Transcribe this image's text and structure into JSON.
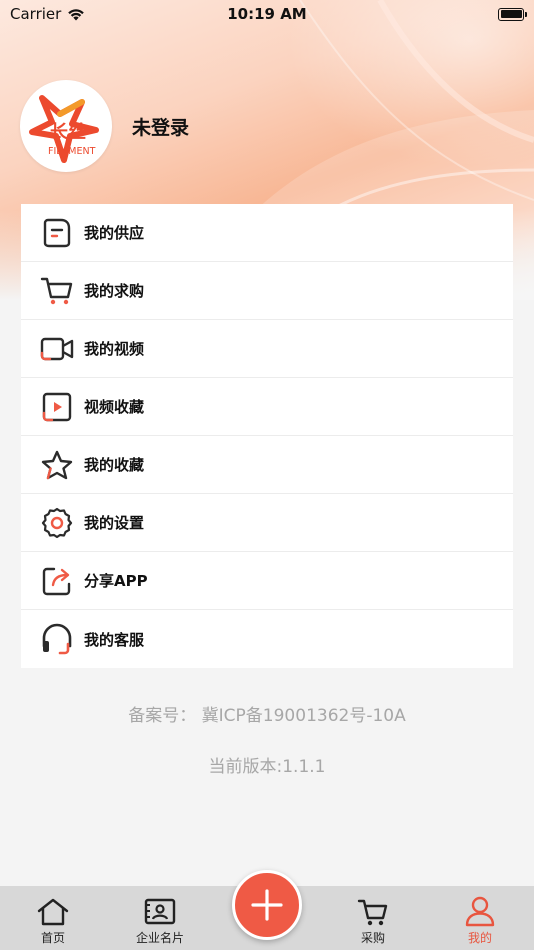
{
  "status_bar": {
    "carrier": "Carrier",
    "time": "10:19 AM"
  },
  "profile": {
    "name": "未登录",
    "logo_text": "长丝",
    "logo_subtext": "FILAMENT"
  },
  "menu": {
    "items": [
      {
        "label": "我的供应",
        "icon": "supply-doc-icon"
      },
      {
        "label": "我的求购",
        "icon": "cart-icon"
      },
      {
        "label": "我的视频",
        "icon": "video-camera-icon"
      },
      {
        "label": "视频收藏",
        "icon": "video-play-icon"
      },
      {
        "label": "我的收藏",
        "icon": "star-icon"
      },
      {
        "label": "我的设置",
        "icon": "gear-icon"
      },
      {
        "label": "分享APP",
        "icon": "share-icon"
      },
      {
        "label": "我的客服",
        "icon": "headset-icon"
      }
    ]
  },
  "footer": {
    "icp": "备案号： 冀ICP备19001362号-10A",
    "version": "当前版本:1.1.1"
  },
  "tabbar": {
    "items": [
      {
        "label": "首页",
        "icon": "home-icon"
      },
      {
        "label": "企业名片",
        "icon": "business-card-icon"
      },
      {
        "label": "采购",
        "icon": "cart-icon"
      },
      {
        "label": "我的",
        "icon": "user-icon"
      }
    ],
    "active": "我的"
  },
  "colors": {
    "accent": "#ef5a45",
    "icon_dark": "#2b2b2b",
    "footer_text": "#a7a7a7"
  }
}
